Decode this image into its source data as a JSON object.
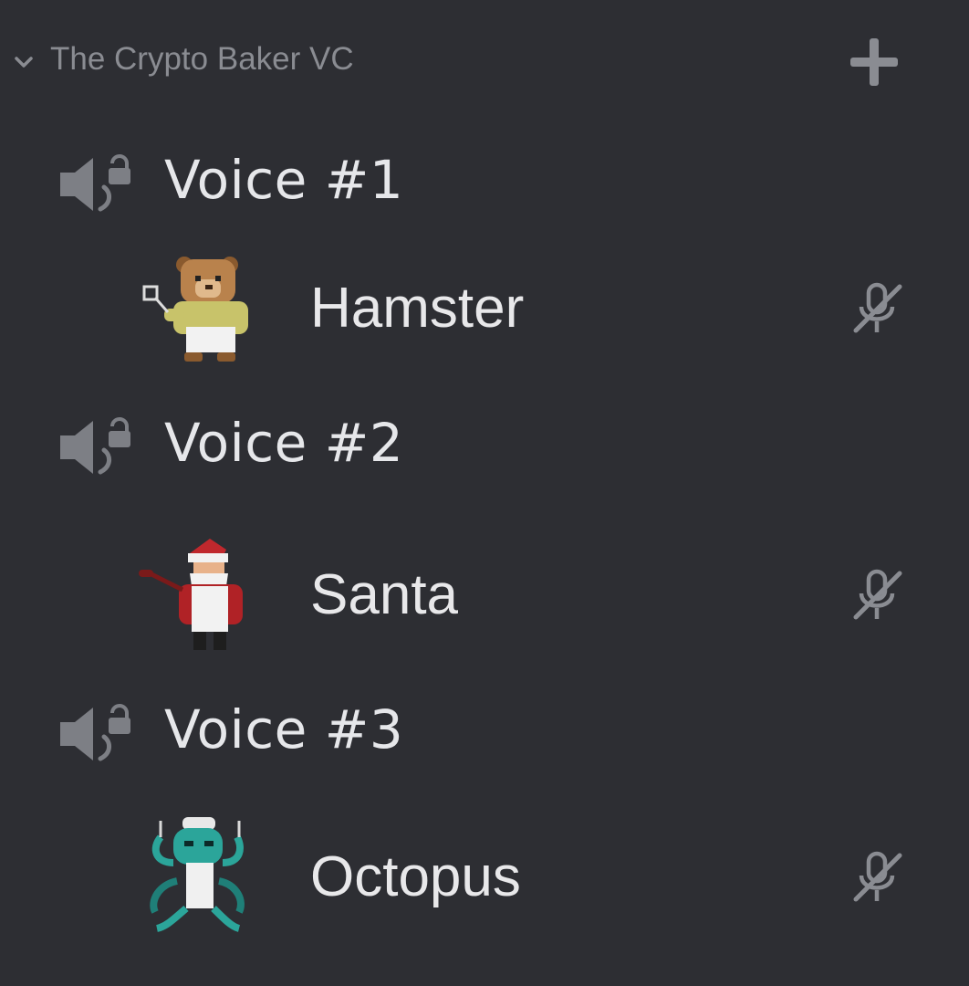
{
  "category": {
    "name": "The Crypto Baker VC",
    "icons": [
      "chevron-down-icon",
      "plus-icon"
    ]
  },
  "channels": [
    {
      "name": "Voice #1",
      "icon": "locked-speaker-icon",
      "user": {
        "name": "Hamster",
        "avatar": "hamster-baker-avatar",
        "status_icon": "mic-muted-icon"
      }
    },
    {
      "name": "Voice #2",
      "icon": "locked-speaker-icon",
      "user": {
        "name": "Santa",
        "avatar": "santa-baker-avatar",
        "status_icon": "mic-muted-icon"
      }
    },
    {
      "name": "Voice #3",
      "icon": "locked-speaker-icon",
      "user": {
        "name": "Octopus",
        "avatar": "octopus-baker-avatar",
        "status_icon": "mic-muted-icon"
      }
    }
  ],
  "colors": {
    "background": "#2d2e33",
    "muted_text": "#8a8c92",
    "primary_text": "#e6e7ea",
    "icon": "#7d7f85"
  }
}
